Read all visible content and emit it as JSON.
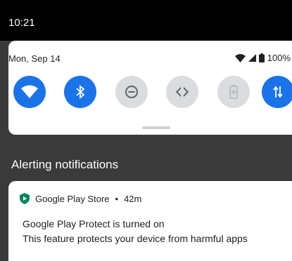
{
  "status_bar": {
    "time": "10:21"
  },
  "quick_settings": {
    "date": "Mon, Sep 14",
    "battery_percent": "100%",
    "icons": {
      "wifi": "wifi-signal-icon",
      "cell": "cellular-signal-icon",
      "battery": "battery-icon"
    },
    "tiles": [
      {
        "name": "wifi",
        "icon": "wifi-icon",
        "active": true
      },
      {
        "name": "bluetooth",
        "icon": "bluetooth-icon",
        "active": true
      },
      {
        "name": "do-not-disturb",
        "icon": "do-not-disturb-icon",
        "active": false
      },
      {
        "name": "auto-rotate",
        "icon": "auto-rotate-icon",
        "active": false
      },
      {
        "name": "battery-saver",
        "icon": "battery-saver-icon",
        "active": false
      },
      {
        "name": "mobile-data",
        "icon": "mobile-data-icon",
        "active": true
      }
    ]
  },
  "notifications": {
    "section_title": "Alerting notifications",
    "items": [
      {
        "app": "Google Play Store",
        "time": "42m",
        "title": "Google Play Protect is turned on",
        "text": "This feature protects your device from harmful apps",
        "icon": "play-protect-icon"
      }
    ]
  },
  "colors": {
    "accent": "#1a73e8",
    "play_protect": "#01875f",
    "scrim": "#3a3a3a"
  }
}
